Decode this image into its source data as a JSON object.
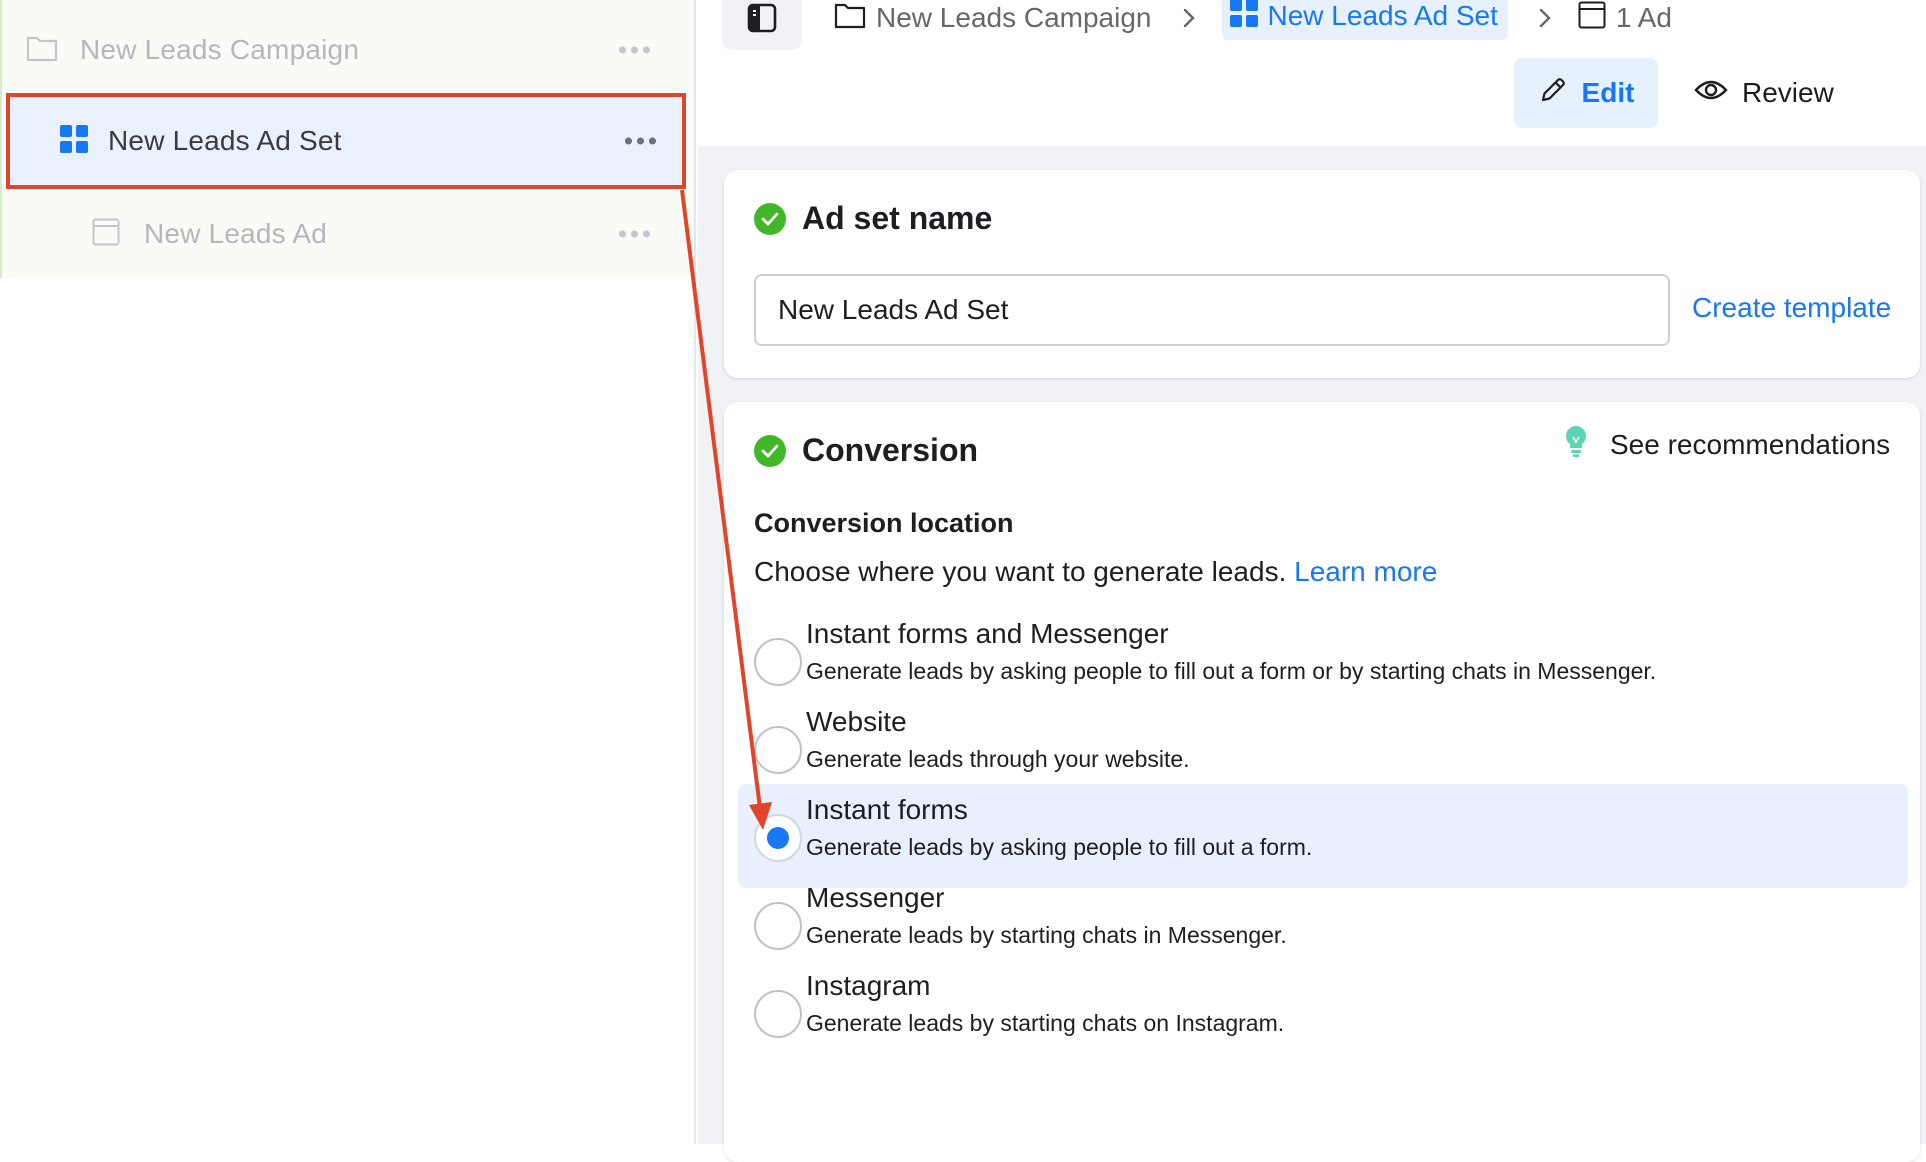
{
  "tree": {
    "campaign": {
      "label": "New Leads Campaign",
      "icon": "folder-icon"
    },
    "adset": {
      "label": "New Leads Ad Set",
      "icon": "grid-icon"
    },
    "ad": {
      "label": "New Leads Ad",
      "icon": "ad-frame-icon"
    }
  },
  "breadcrumb": {
    "campaign": "New Leads Campaign",
    "adset": "New Leads Ad Set",
    "ad": "1 Ad"
  },
  "toolbar": {
    "edit_label": "Edit",
    "review_label": "Review"
  },
  "adset_name_card": {
    "title": "Ad set name",
    "input_value": "New Leads Ad Set",
    "create_template": "Create template"
  },
  "conversion_card": {
    "title": "Conversion",
    "see_recommendations": "See recommendations",
    "location_label": "Conversion location",
    "description": "Choose where you want to generate leads.",
    "learn_more": "Learn more",
    "options": [
      {
        "title": "Instant forms and Messenger",
        "desc": "Generate leads by asking people to fill out a form or by starting chats in Messenger.",
        "selected": false
      },
      {
        "title": "Website",
        "desc": "Generate leads through your website.",
        "selected": false
      },
      {
        "title": "Instant forms",
        "desc": "Generate leads by asking people to fill out a form.",
        "selected": true
      },
      {
        "title": "Messenger",
        "desc": "Generate leads by starting chats in Messenger.",
        "selected": false
      },
      {
        "title": "Instagram",
        "desc": "Generate leads by starting chats on Instagram.",
        "selected": false
      }
    ]
  },
  "colors": {
    "accent": "#1877f2",
    "success": "#42b72a",
    "annotation": "#e0452b",
    "selected_bg": "#e8f0fd"
  }
}
